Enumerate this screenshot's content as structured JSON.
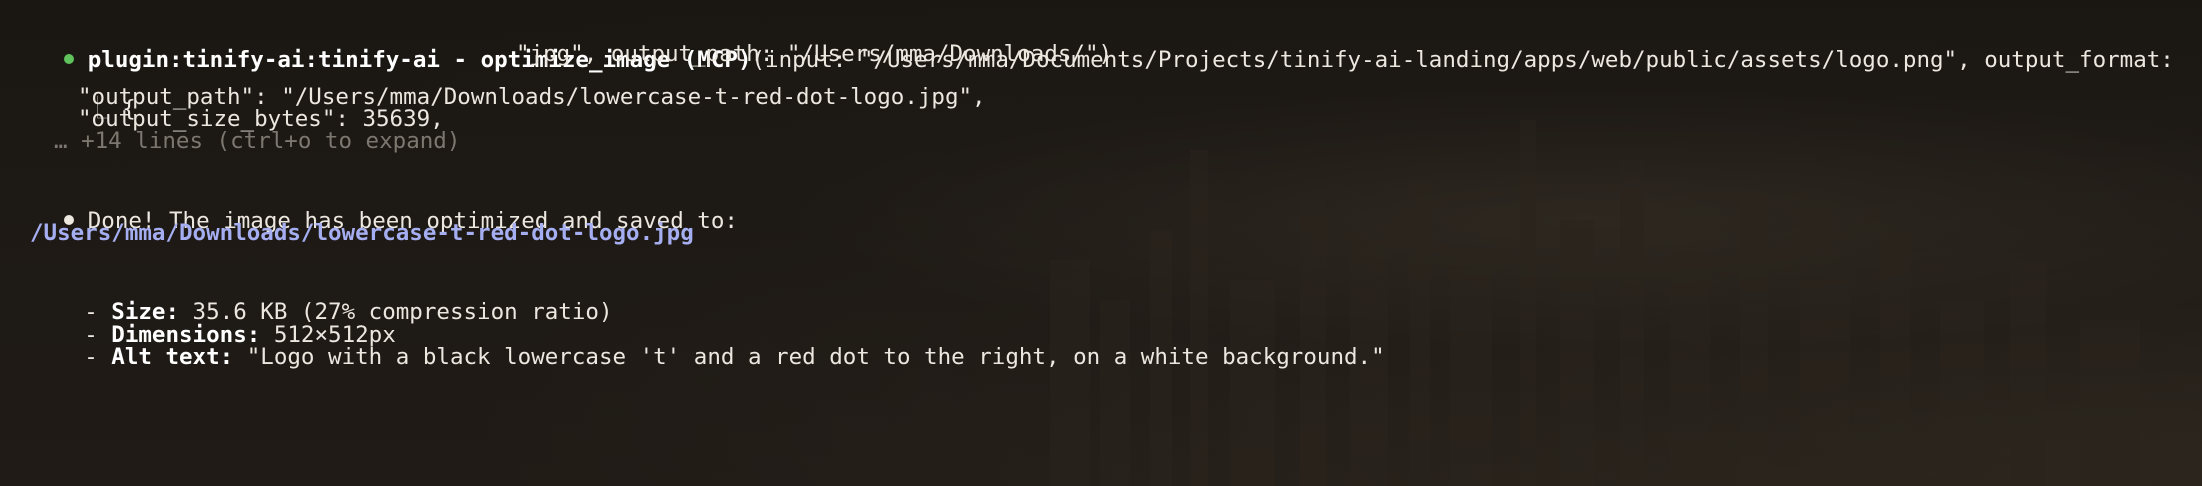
{
  "tool_call": {
    "name": "plugin:tinify-ai:tinify-ai - optimize_image (MCP)",
    "args_line1": "(input: \"/Users/mma/Documents/Projects/tinify-ai-landing/apps/web/public/assets/logo.png\", output_format:",
    "args_line2": "\"jpg\", output_path: \"/Users/mma/Downloads/\")"
  },
  "result": {
    "tree_glyph": "⎿",
    "open_brace": "{",
    "output_path_line": "\"output_path\": \"/Users/mma/Downloads/lowercase-t-red-dot-logo.jpg\",",
    "output_size_line": "\"output_size_bytes\": 35639,",
    "collapsed_line": "… +14 lines (ctrl+o to expand)"
  },
  "message": {
    "done_text": "Done! The image has been optimized and saved to:",
    "saved_path": "/Users/mma/Downloads/lowercase-t-red-dot-logo.jpg",
    "items": [
      {
        "prefix": "- ",
        "label": "Size:",
        "value": " 35.6 KB (27% compression ratio)"
      },
      {
        "prefix": "- ",
        "label": "Dimensions:",
        "value": " 512×512px"
      },
      {
        "prefix": "- ",
        "label": "Alt text:",
        "value": " \"Logo with a black lowercase 't' and a red dot to the right, on a white background.\""
      }
    ]
  },
  "colors": {
    "status_bullet": "#5fc25d",
    "link": "#a5aef0",
    "dim": "#7c776f"
  }
}
